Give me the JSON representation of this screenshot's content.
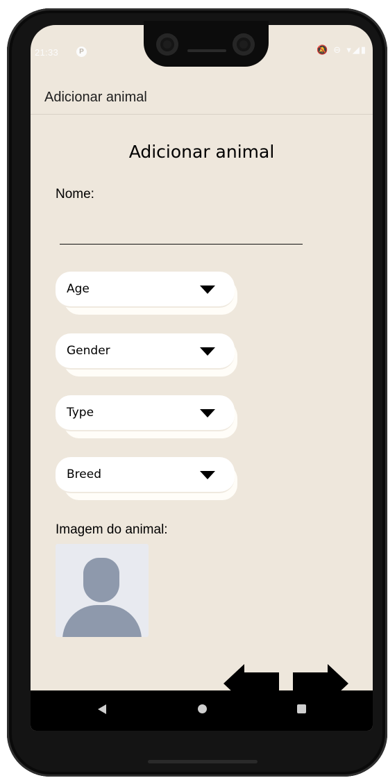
{
  "status_bar": {
    "time": "21:33",
    "app_icon": "P",
    "icons": "🔕 ⊖ ▾◢▮"
  },
  "app_bar": {
    "title": "Adicionar animal"
  },
  "form": {
    "heading": "Adicionar animal",
    "name_label": "Nome:",
    "name_value": "",
    "dropdowns": [
      {
        "label": "Age"
      },
      {
        "label": "Gender"
      },
      {
        "label": "Type"
      },
      {
        "label": "Breed"
      }
    ],
    "image_label": "Imagem do animal:"
  },
  "colors": {
    "screen_background": "#eee7dc",
    "dropdown_background": "#ffffff",
    "avatar_placeholder": "#8e99ac",
    "nav_bar": "#000000"
  },
  "icons": {
    "dropdown": "caret-down-icon",
    "avatar": "person-placeholder-icon",
    "prev": "arrow-left-icon",
    "next": "arrow-right-icon"
  }
}
